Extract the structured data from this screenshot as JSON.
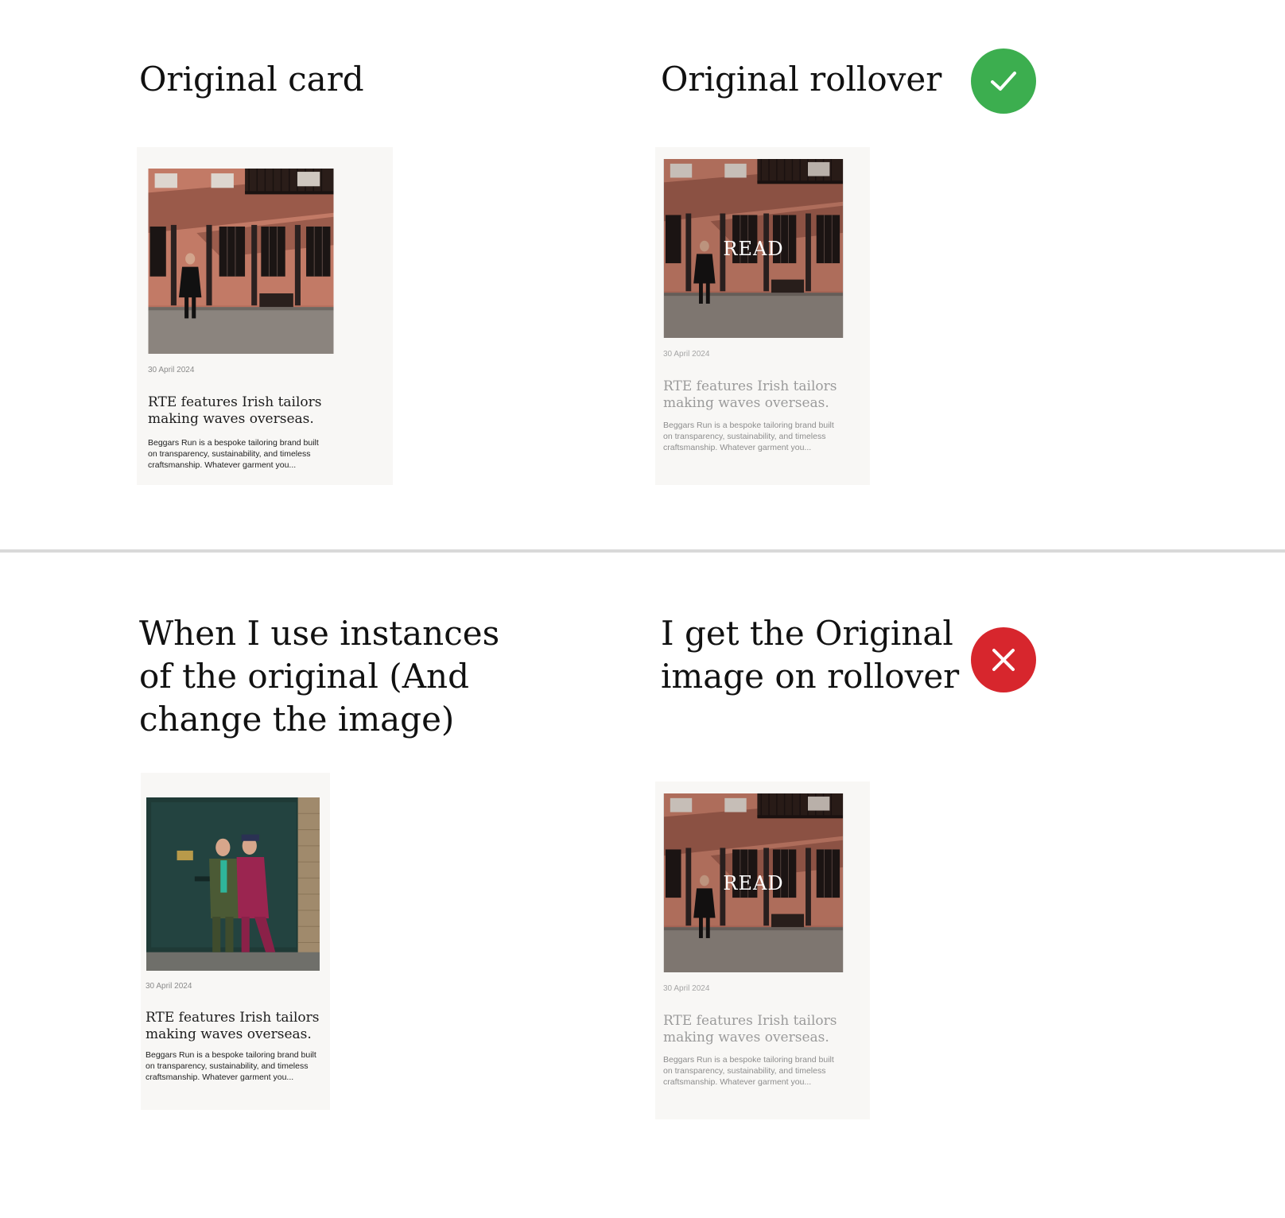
{
  "panels": {
    "top_left": {
      "heading": [
        "Original card"
      ]
    },
    "top_right": {
      "heading": [
        "Original rollover"
      ],
      "status": "check-icon"
    },
    "bottom_left": {
      "heading": [
        "When I use instances",
        "of the original (And",
        "change the image)"
      ]
    },
    "bottom_right": {
      "heading": [
        "I get the Original",
        "image on rollover"
      ],
      "status": "cross-icon"
    }
  },
  "colors": {
    "success": "#3cae4f",
    "error": "#d7262d",
    "card_background": "#f8f7f5",
    "divider": "#d9d9d9"
  },
  "card": {
    "date": "30 April 2024",
    "title_lines": [
      "RTE features Irish tailors",
      "making waves overseas."
    ],
    "excerpt_lines": [
      "Beggars Run is a bespoke tailoring brand built",
      "on transparency, sustainability, and timeless",
      "craftsmanship. Whatever garment you..."
    ],
    "rollover_label": "READ"
  }
}
